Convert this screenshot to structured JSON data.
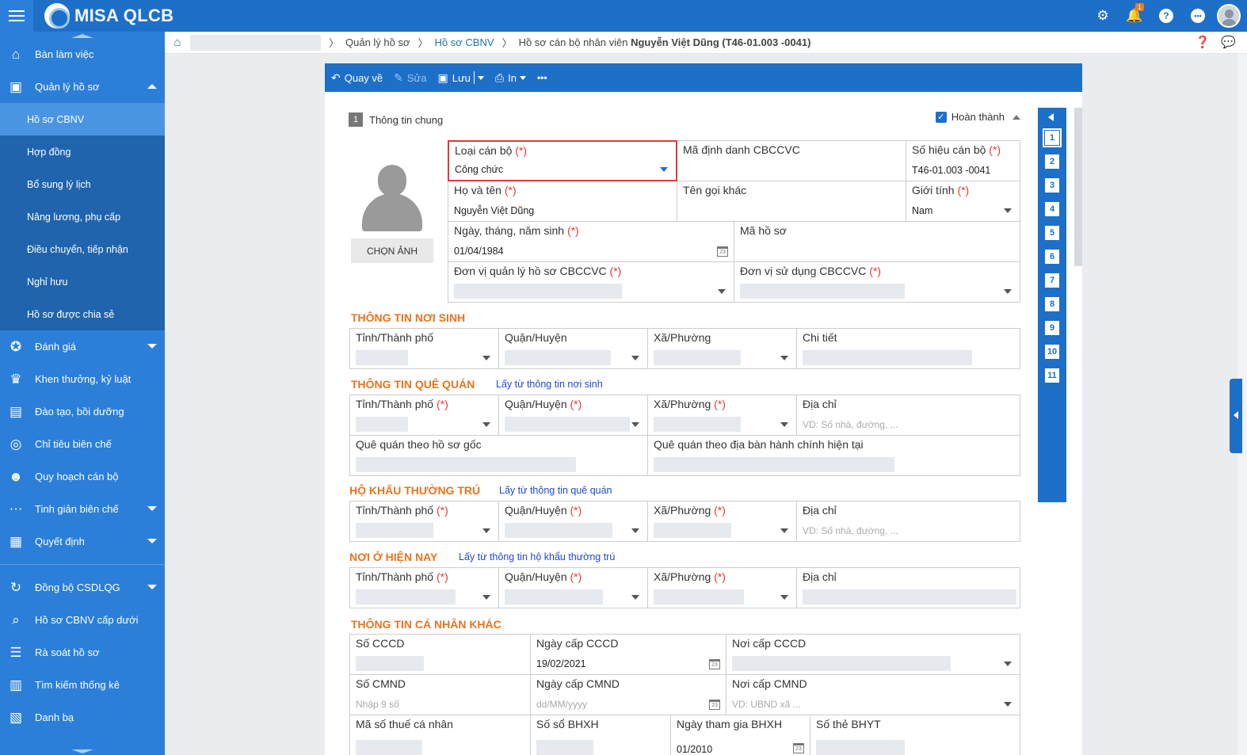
{
  "app": {
    "title": "MISA QLCB",
    "notification_count": "1"
  },
  "sidebar": {
    "items": [
      {
        "label": "Bàn làm việc",
        "icon": "home-icon"
      },
      {
        "label": "Quản lý hồ sơ",
        "icon": "briefcase-icon"
      },
      {
        "label": "Đánh giá",
        "icon": "medal-icon"
      },
      {
        "label": "Khen thưởng, kỷ luật",
        "icon": "trophy-icon"
      },
      {
        "label": "Đào tạo, bồi dưỡng",
        "icon": "training-icon"
      },
      {
        "label": "Chỉ tiêu biên chế",
        "icon": "target-icon"
      },
      {
        "label": "Quy hoạch cán bộ",
        "icon": "people-icon"
      },
      {
        "label": "Tinh giản biên chế",
        "icon": "more-icon"
      },
      {
        "label": "Quyết định",
        "icon": "clipboard-icon"
      },
      {
        "label": "Đồng bộ CSDLQG",
        "icon": "sync-icon"
      },
      {
        "label": "Hồ sơ CBNV cấp dưới",
        "icon": "search-icon"
      },
      {
        "label": "Rà soát hồ sơ",
        "icon": "review-icon"
      },
      {
        "label": "Tìm kiếm thống kê",
        "icon": "chart-icon"
      },
      {
        "label": "Danh bạ",
        "icon": "contacts-icon"
      }
    ],
    "sub": [
      "Hồ sơ CBNV",
      "Hợp đồng",
      "Bổ sung lý lịch",
      "Nâng lương, phụ cấp",
      "Điều chuyển, tiếp nhận",
      "Nghỉ hưu",
      "Hồ sơ được chia sẻ"
    ]
  },
  "breadcrumb": {
    "c1": "Quản lý hồ sơ",
    "c2": "Hồ sơ CBNV",
    "c3_prefix": "Hồ sơ cán bộ nhân viên ",
    "c3_name": "Nguyễn Việt Dũng (T46-01.003 -0041)"
  },
  "toolbar": {
    "back": "Quay về",
    "edit": "Sửa",
    "save": "Lưu",
    "print": "In",
    "more": "•••"
  },
  "section1": {
    "num": "1",
    "title": "Thông tin chung",
    "done": "Hoàn thành"
  },
  "photo": {
    "button": "CHỌN ẢNH"
  },
  "req": "(*)",
  "general": {
    "loai_can_bo": {
      "label": "Loại cán bộ",
      "value": "Công chức"
    },
    "ma_dinh_danh": {
      "label": "Mã định danh CBCCVC"
    },
    "so_hieu": {
      "label": "Số hiệu cán bộ",
      "value": "T46-01.003 -0041"
    },
    "ho_ten": {
      "label": "Họ và tên",
      "value": "Nguyễn Việt Dũng"
    },
    "ten_goi_khac": {
      "label": "Tên gọi khác"
    },
    "gioi_tinh": {
      "label": "Giới tính",
      "value": "Nam"
    },
    "ngay_sinh": {
      "label": "Ngày, tháng, năm sinh",
      "value": "01/04/1984"
    },
    "ma_ho_so": {
      "label": "Mã hồ sơ"
    },
    "don_vi_quan_ly": {
      "label": "Đơn vị quản lý hồ sơ CBCCVC"
    },
    "don_vi_su_dung": {
      "label": "Đơn vị sử dụng CBCCVC"
    }
  },
  "noi_sinh": {
    "title": "THÔNG TIN NƠI SINH",
    "tinh": "Tỉnh/Thành phố",
    "huyen": "Quận/Huyện",
    "xa": "Xã/Phường",
    "chi_tiet": "Chi tiết"
  },
  "que_quan": {
    "title": "THÔNG TIN QUÊ QUÁN",
    "link": "Lấy từ thông tin nơi sinh",
    "tinh": "Tỉnh/Thành phố",
    "huyen": "Quận/Huyện",
    "xa": "Xã/Phường",
    "dia_chi": "Địa chỉ",
    "dia_chi_ph": "VD: Số nhà, đường, ...",
    "goc": "Quê quán theo hồ sơ gốc",
    "hien_tai": "Quê quán theo địa bàn hành chính hiện tại"
  },
  "ho_khau": {
    "title": "HỘ KHẨU THƯỜNG TRÚ",
    "link": "Lấy từ thông tin quê quán",
    "tinh": "Tỉnh/Thành phố",
    "huyen": "Quận/Huyện",
    "xa": "Xã/Phường",
    "dia_chi": "Địa chỉ",
    "dia_chi_ph": "VD: Số nhà, đường, ..."
  },
  "noi_o": {
    "title": "NƠI Ở HIỆN NAY",
    "link": "Lấy từ thông tin hộ khẩu thường trú",
    "tinh": "Tỉnh/Thành phố",
    "huyen": "Quận/Huyện",
    "xa": "Xã/Phường",
    "dia_chi": "Địa chỉ"
  },
  "ca_nhan": {
    "title": "THÔNG TIN CÁ NHÂN KHÁC",
    "so_cccd": "Số CCCD",
    "ngay_cap_cccd": "Ngày cấp CCCD",
    "ngay_cap_cccd_val": "19/02/2021",
    "noi_cap_cccd": "Nơi cấp CCCD",
    "so_cmnd": "Số CMND",
    "so_cmnd_ph": "Nhập 9 số",
    "ngay_cap_cmnd": "Ngày cấp CMND",
    "ngay_cap_cmnd_ph": "dd/MM/yyyy",
    "noi_cap_cmnd": "Nơi cấp CMND",
    "noi_cap_cmnd_ph": "VD: UBND xã ...",
    "mst": "Mã số thuế cá nhân",
    "so_bhxh": "Số sổ BHXH",
    "ngay_bhxh": "Ngày tham gia BHXH",
    "ngay_bhxh_val": "01/2010",
    "so_bhyt": "Số thẻ BHYT"
  },
  "numnav": [
    "1",
    "2",
    "3",
    "4",
    "5",
    "6",
    "7",
    "8",
    "9",
    "10",
    "11"
  ]
}
